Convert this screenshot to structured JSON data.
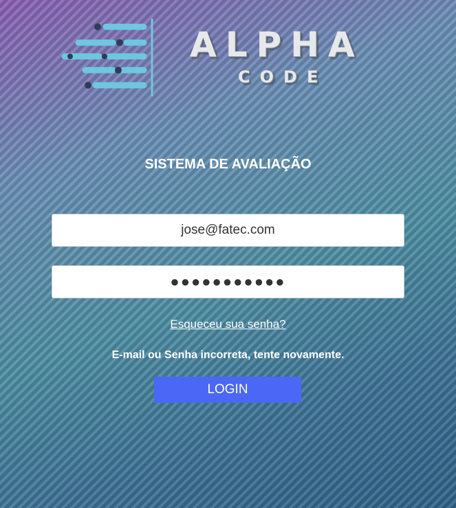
{
  "brand": {
    "logo_name": "ALPHA CODE",
    "logo_icon": "circuit-arrows-icon",
    "colors": {
      "accent": "#4a68f5",
      "logo_bars": "#6ec7df"
    }
  },
  "form": {
    "title": "SISTEMA DE AVALIAÇÃO",
    "email_value": "jose@fatec.com",
    "password_value": "●●●●●●●●●●●",
    "forgot_link": "Esqueceu sua senha?",
    "error_message": "E-mail ou Senha incorreta, tente novamente.",
    "login_label": "LOGIN"
  }
}
